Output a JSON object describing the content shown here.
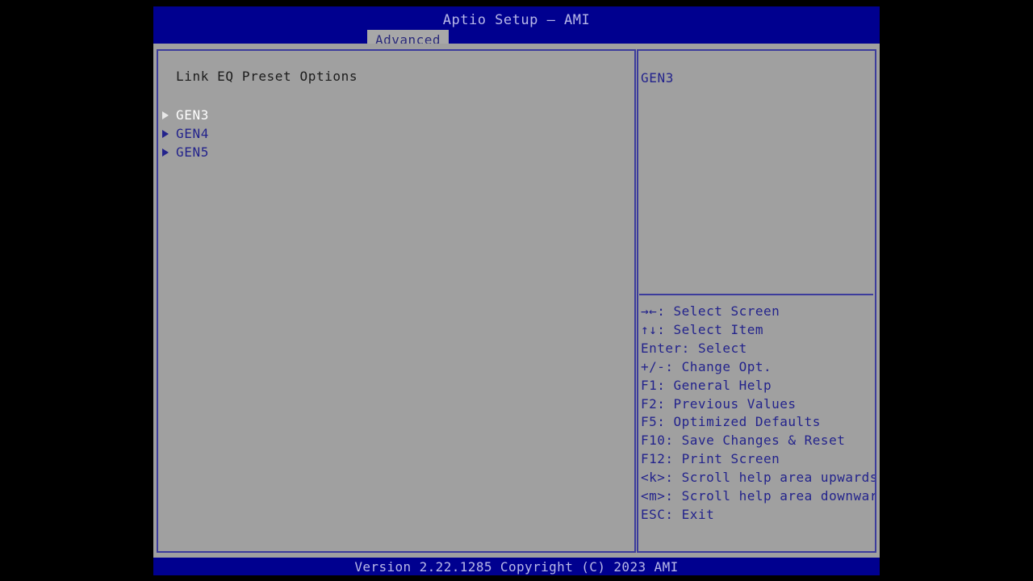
{
  "header": {
    "title": "Aptio Setup – AMI",
    "tabs": [
      {
        "label": "Advanced",
        "active": true
      }
    ]
  },
  "main": {
    "section_heading": "Link EQ Preset Options",
    "menu_items": [
      {
        "label": "GEN3",
        "arrow": "submenu-arrow-icon",
        "selected": true
      },
      {
        "label": "GEN4",
        "arrow": "submenu-arrow-icon",
        "selected": false
      },
      {
        "label": "GEN5",
        "arrow": "submenu-arrow-icon",
        "selected": false
      }
    ]
  },
  "help": {
    "text": "GEN3",
    "legend": [
      {
        "key": "→←",
        "desc": ": Select Screen"
      },
      {
        "key": "↑↓",
        "desc": ": Select Item"
      },
      {
        "key": "Enter",
        "desc": ": Select"
      },
      {
        "key": "+/-",
        "desc": ": Change Opt."
      },
      {
        "key": "F1",
        "desc": ": General Help"
      },
      {
        "key": "F2",
        "desc": ": Previous Values"
      },
      {
        "key": "F5",
        "desc": ": Optimized Defaults"
      },
      {
        "key": "F10",
        "desc": ": Save Changes & Reset"
      },
      {
        "key": "F12",
        "desc": ": Print Screen"
      },
      {
        "key": "<k>",
        "desc": ": Scroll help area upwards"
      },
      {
        "key": "<m>",
        "desc": ": Scroll help area downwards"
      },
      {
        "key": "ESC",
        "desc": ": Exit"
      }
    ]
  },
  "footer": {
    "version_text": "Version 2.22.1285 Copyright (C) 2023 AMI"
  },
  "colors": {
    "header_blue": "#00008f",
    "panel_gray": "#a0a0a0",
    "border_blue": "#3c3c9c",
    "text_blue": "#23238c",
    "title_text": "#b8b8e8",
    "selected_text": "#ffffff",
    "heading_text": "#1c1c1c"
  }
}
